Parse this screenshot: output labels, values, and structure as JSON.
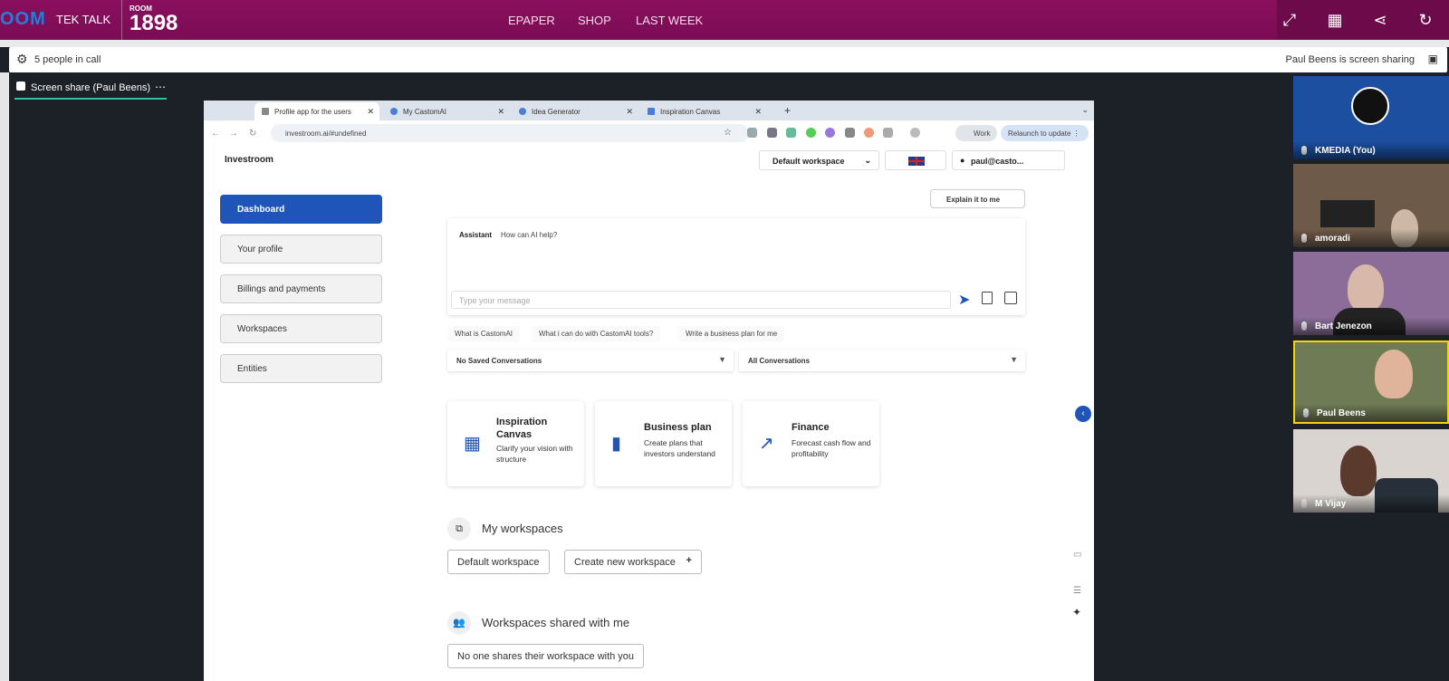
{
  "header": {
    "logo_fragment": "OOM",
    "show_name": "TEK TALK",
    "room_label": "ROOM",
    "room_number": "1898",
    "nav": [
      "EPAPER",
      "SHOP",
      "LAST WEEK"
    ],
    "icons": [
      "expand-icon",
      "grid-icon",
      "share-icon",
      "refresh-icon"
    ]
  },
  "call": {
    "people": "5 people in call",
    "sharing": "Paul Beens is screen sharing",
    "share_tab": "Screen share (Paul Beens)",
    "share_tab_more": "⋯"
  },
  "browser": {
    "tabs": [
      {
        "label": "Profile app for the users"
      },
      {
        "label": "My CastomAI"
      },
      {
        "label": "Idea Generator"
      },
      {
        "label": "Inspiration Canvas"
      }
    ],
    "tab_close": "✕",
    "new_tab": "+",
    "tab_menu": "⌄",
    "url": "investroom.ai/#undefined",
    "profile": "Work",
    "relaunch": "Relaunch to update  ⋮"
  },
  "app": {
    "brand": "Investroom",
    "workspace_select": "Default workspace",
    "user": "paul@casto...",
    "sidebar": [
      "Dashboard",
      "Your profile",
      "Billings and payments",
      "Workspaces",
      "Entities"
    ],
    "explain": "Explain it to me",
    "assistant_label": "Assistant",
    "assistant_prompt": "How can AI help?",
    "message_placeholder": "Type your message",
    "chips": [
      "What is CastomAI",
      "What i can do with CastomAI tools?",
      "Write a business plan for me"
    ],
    "saved_conversations": "No Saved Conversations",
    "all_conversations": "All Conversations",
    "cards": [
      {
        "title": "Inspiration Canvas",
        "desc": "Clarify your vision with structure"
      },
      {
        "title": "Business plan",
        "desc": "Create plans that investors understand"
      },
      {
        "title": "Finance",
        "desc": "Forecast cash flow and profitability"
      }
    ],
    "my_workspaces": "My workspaces",
    "default_workspace_btn": "Default workspace",
    "create_workspace_btn": "Create new workspace",
    "shared_heading": "Workspaces shared with me",
    "no_shared": "No one shares their workspace with you"
  },
  "participants": [
    {
      "name": "KMEDIA (You)"
    },
    {
      "name": "amoradi"
    },
    {
      "name": "Bart Jenezon"
    },
    {
      "name": "Paul Beens"
    },
    {
      "name": "M Vijay"
    }
  ],
  "colors": {
    "brand_bar": "#7b0c54",
    "accent": "#1f54b8",
    "speaker_highlight": "#f2d40f"
  }
}
